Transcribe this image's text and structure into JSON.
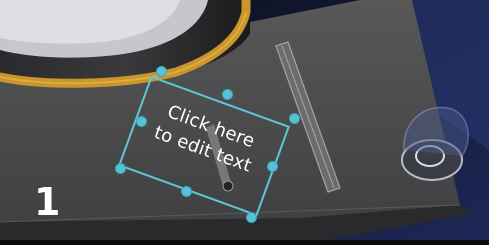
{
  "editor": {
    "textbox": {
      "placeholder_text": "Click here\nto edit text",
      "border_color": "#5ec8d8",
      "handle_color": "#56c2d6"
    },
    "step_label": "1"
  },
  "scene": {
    "icons": [
      "rotated-text-box",
      "resize-handle"
    ],
    "colors": {
      "surface": "#4b4b4d",
      "rim": "#c9962b",
      "background": "#17204a"
    }
  }
}
